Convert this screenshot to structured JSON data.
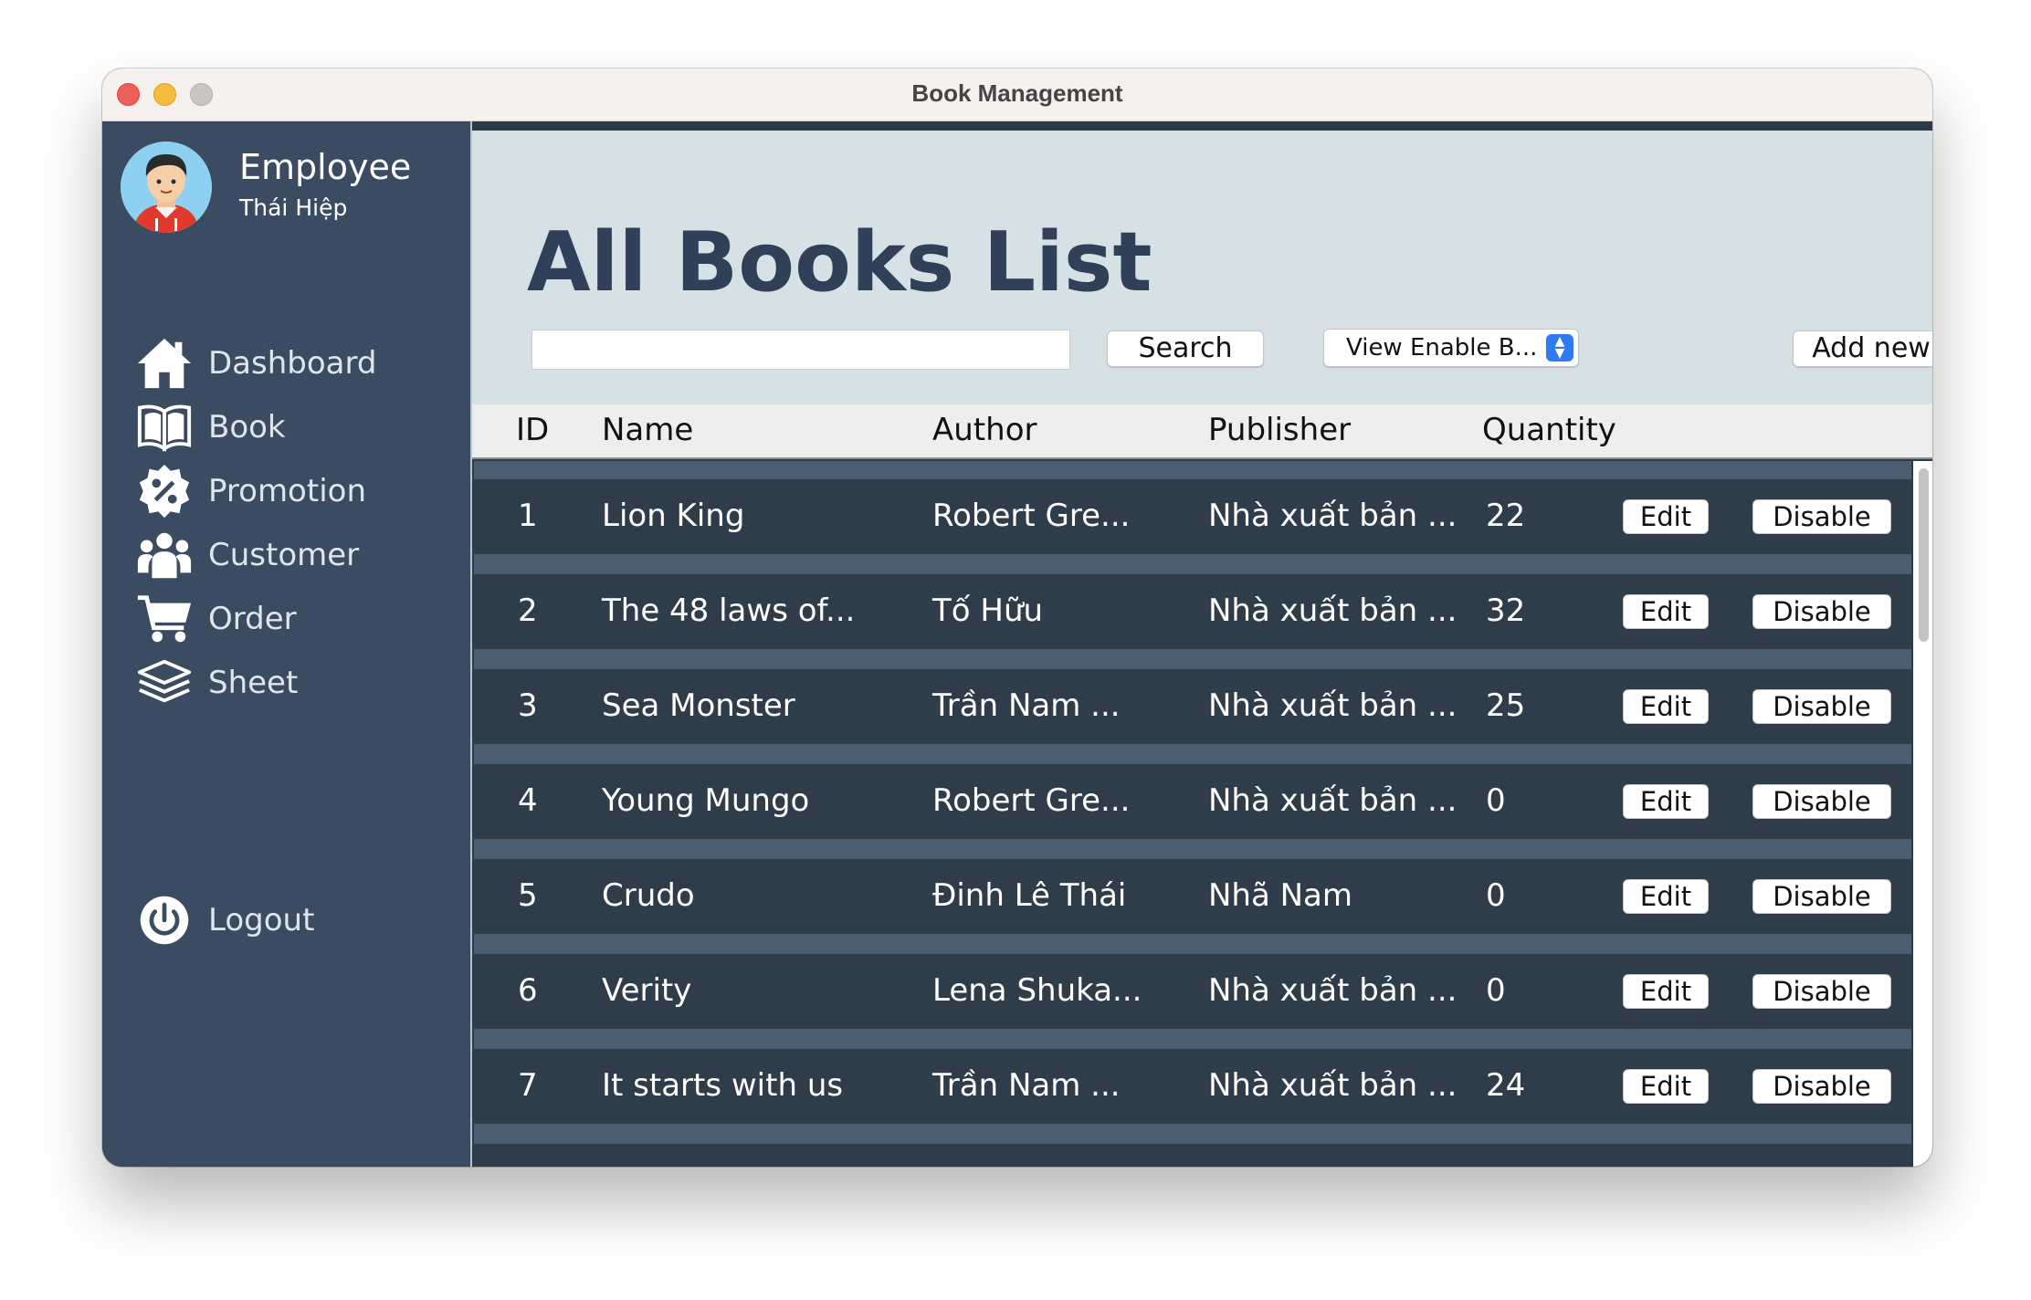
{
  "window": {
    "title": "Book Management"
  },
  "user": {
    "role": "Employee",
    "name": "Thái Hiệp"
  },
  "nav": {
    "items": [
      {
        "label": "Dashboard",
        "icon": "home-icon"
      },
      {
        "label": "Book",
        "icon": "book-icon"
      },
      {
        "label": "Promotion",
        "icon": "promotion-badge-icon"
      },
      {
        "label": "Customer",
        "icon": "customers-icon"
      },
      {
        "label": "Order",
        "icon": "cart-icon"
      },
      {
        "label": "Sheet",
        "icon": "layers-icon"
      }
    ],
    "logout": {
      "label": "Logout",
      "icon": "power-icon"
    }
  },
  "main": {
    "title": "All Books List",
    "search": {
      "value": "",
      "placeholder": ""
    },
    "search_button": "Search",
    "filter": {
      "selected": "View Enable B..."
    },
    "add_button": "Add new"
  },
  "table": {
    "columns": [
      "ID",
      "Name",
      "Author",
      "Publisher",
      "Quantity"
    ],
    "edit_label": "Edit",
    "disable_label": "Disable",
    "rows": [
      {
        "id": "1",
        "name": "Lion King",
        "author": "Robert Gre...",
        "publisher": "Nhà xuất bản ...",
        "quantity": "22"
      },
      {
        "id": "2",
        "name": "The 48 laws of...",
        "author": "Tố Hữu",
        "publisher": "Nhà xuất bản ...",
        "quantity": "32"
      },
      {
        "id": "3",
        "name": "Sea Monster",
        "author": "Trần Nam ...",
        "publisher": "Nhà xuất bản ...",
        "quantity": "25"
      },
      {
        "id": "4",
        "name": "Young Mungo",
        "author": "Robert Gre...",
        "publisher": "Nhà xuất bản ...",
        "quantity": "0"
      },
      {
        "id": "5",
        "name": "Crudo",
        "author": "Đinh Lê Thái",
        "publisher": "Nhã Nam",
        "quantity": "0"
      },
      {
        "id": "6",
        "name": "Verity",
        "author": "Lena Shuka...",
        "publisher": "Nhà xuất bản ...",
        "quantity": "0"
      },
      {
        "id": "7",
        "name": "It starts with us",
        "author": "Trần Nam ...",
        "publisher": "Nhà xuất bản ...",
        "quantity": "24"
      }
    ]
  },
  "colors": {
    "sidebar": "#3a4b62",
    "header": "#d5e1e5",
    "title": "#2f4058",
    "row": "#2f3c4a",
    "row_gap": "#4b5e72"
  }
}
